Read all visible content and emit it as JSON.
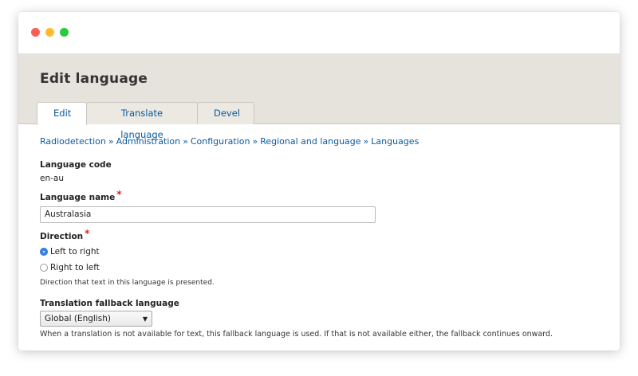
{
  "window": {
    "controls": [
      "close",
      "minimize",
      "maximize"
    ]
  },
  "header": {
    "title": "Edit language",
    "tabs": [
      {
        "label": "Edit",
        "active": true
      },
      {
        "label": "Translate language",
        "active": false
      },
      {
        "label": "Devel",
        "active": false
      }
    ]
  },
  "breadcrumb": {
    "items": [
      "Radiodetection",
      "Administration",
      "Configuration",
      "Regional and language",
      "Languages"
    ],
    "separator": "»"
  },
  "form": {
    "language_code": {
      "label": "Language code",
      "value": "en-au"
    },
    "language_name": {
      "label": "Language name",
      "required_marker": "*",
      "value": "Australasia"
    },
    "direction": {
      "label": "Direction",
      "required_marker": "*",
      "options": [
        {
          "label": "Left to right",
          "checked": true
        },
        {
          "label": "Right to left",
          "checked": false
        }
      ],
      "description": "Direction that text in this language is presented."
    },
    "fallback": {
      "label": "Translation fallback language",
      "selected": "Global (English)",
      "description": "When a translation is not available for text, this fallback language is used. If that is not available either, the fallback continues onward."
    }
  },
  "colors": {
    "link": "#0a5a9c",
    "header_bg": "#e5e3dc",
    "required": "#e0211b",
    "radio_checked": "#3b86e6"
  }
}
